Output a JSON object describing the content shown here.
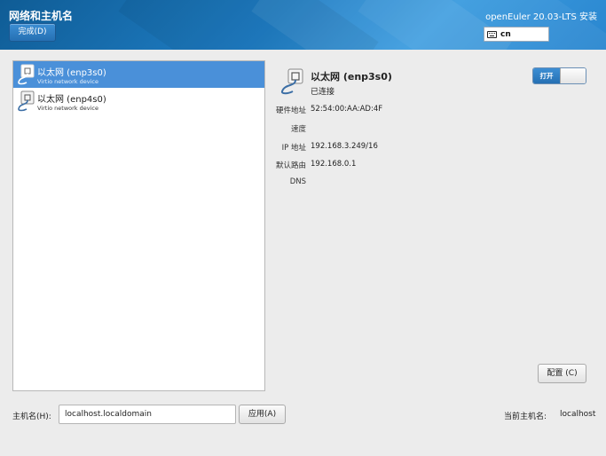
{
  "header": {
    "title": "网络和主机名",
    "done_label": "完成(D)",
    "product": "openEuler 20.03-LTS 安装",
    "keyboard_layout": "cn"
  },
  "devices": [
    {
      "name": "以太网 (enp3s0)",
      "subtitle": "Virtio network device",
      "selected": true
    },
    {
      "name": "以太网 (enp4s0)",
      "subtitle": "Virtio network device",
      "selected": false
    }
  ],
  "detail": {
    "name": "以太网 (enp3s0)",
    "status": "已连接",
    "toggle_label": "打开",
    "toggle_on": true,
    "properties": [
      {
        "label": "硬件地址",
        "value": "52:54:00:AA:AD:4F"
      },
      {
        "label": "速度",
        "value": ""
      },
      {
        "label": "IP 地址",
        "value": "192.168.3.249/16"
      },
      {
        "label": "默认路由",
        "value": "192.168.0.1"
      },
      {
        "label": "DNS",
        "value": ""
      }
    ],
    "configure_label": "配置 (C)"
  },
  "hostname": {
    "label": "主机名(H):",
    "value": "localhost.localdomain",
    "apply_label": "应用(A)",
    "current_label": "当前主机名:",
    "current_value": "localhost"
  },
  "colors": {
    "header_blue": "#1f7dc4",
    "selection_blue": "#4a90d9",
    "background": "#ececec"
  }
}
